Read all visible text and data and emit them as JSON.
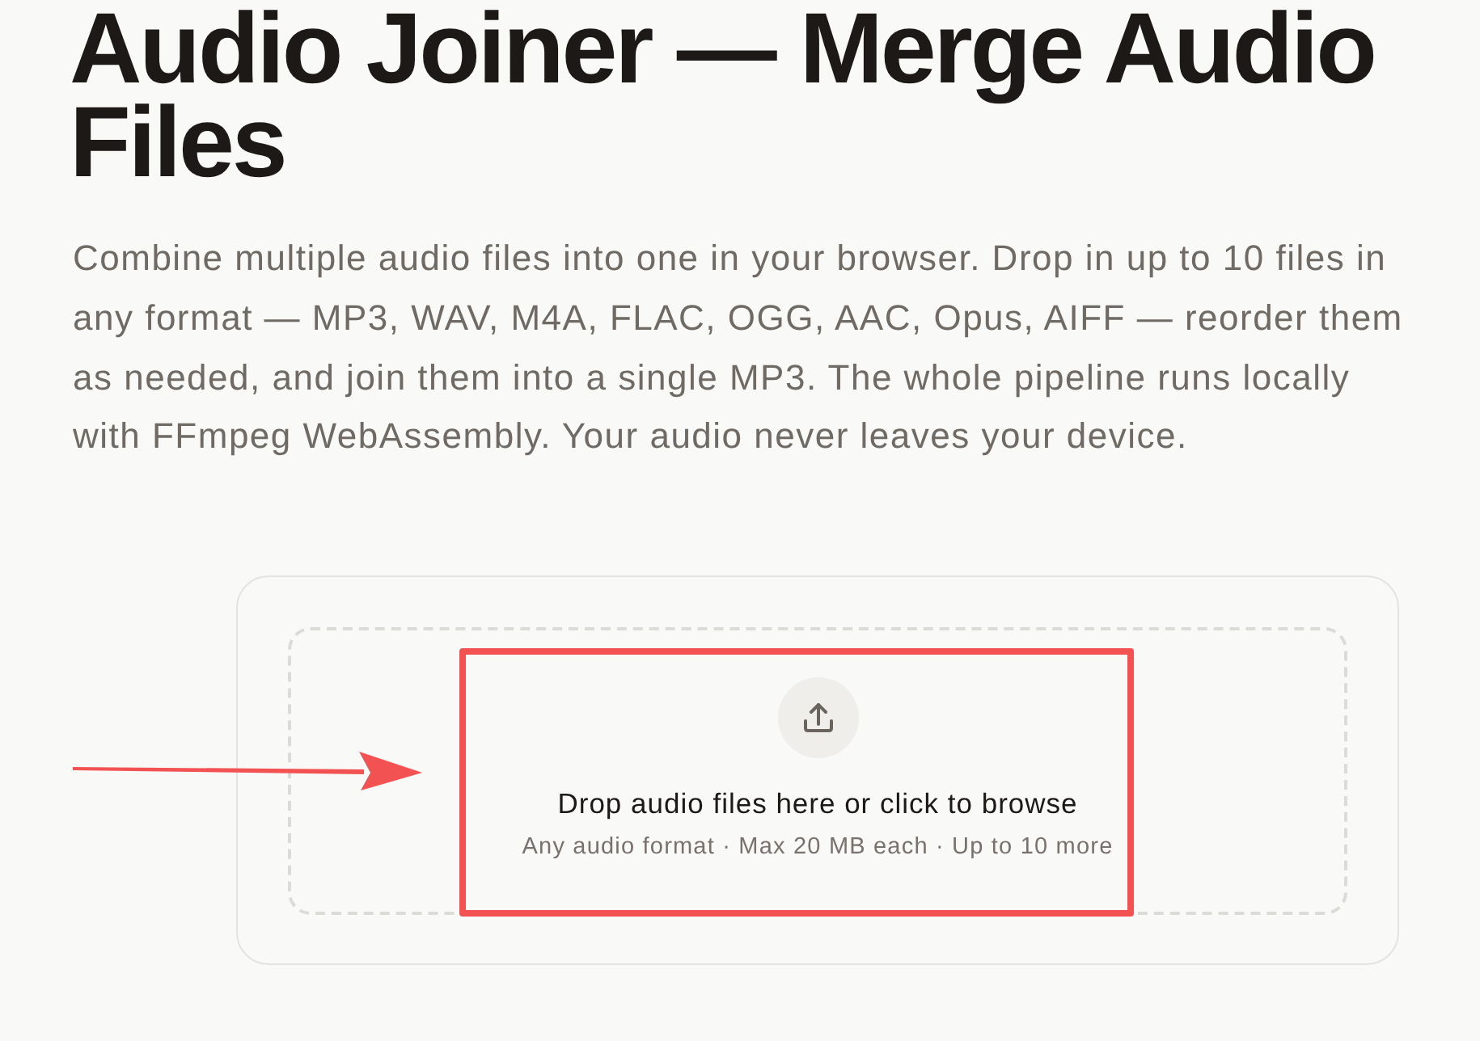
{
  "heading": "Audio Joiner — Merge Audio Files",
  "intro": "Combine multiple audio files into one in your browser. Drop in up to 10 files in any format — MP3, WAV, M4A, FLAC, OGG, AAC, Opus, AIFF — reorder them as needed, and join them into a single MP3. The whole pipeline runs locally with FFmpeg WebAssembly. Your audio never leaves your device.",
  "dropzone": {
    "title": "Drop audio files here or click to browse",
    "hint": "Any audio format · Max 20 MB each · Up to 10 more"
  }
}
